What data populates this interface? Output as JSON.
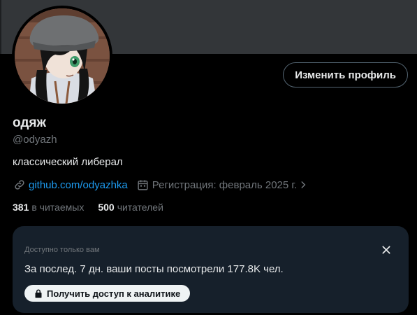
{
  "profile": {
    "display_name": "одяж",
    "handle": "@odyazh",
    "bio": "классический либерал",
    "edit_button": "Изменить профиль",
    "link_text": "github.com/odyazhka",
    "joined_text": "Регистрация: февраль 2025 г.",
    "following_count": "381",
    "following_label": "в читаемых",
    "followers_count": "500",
    "followers_label": "читателей"
  },
  "analytics": {
    "only_you": "Доступно только вам",
    "views_text": "За послед. 7 дн. ваши посты посмотрели 177.8K чел.",
    "cta_label": "Получить доступ к аналитике"
  },
  "icons": {
    "link": "link-icon",
    "calendar": "calendar-icon",
    "chevron": "chevron-right-icon",
    "close": "close-icon",
    "lock": "lock-icon"
  },
  "colors": {
    "background": "#000000",
    "banner": "#333639",
    "link": "#1d9bf0",
    "muted": "#71767b",
    "card": "#16202b",
    "text": "#e7e9ea"
  }
}
